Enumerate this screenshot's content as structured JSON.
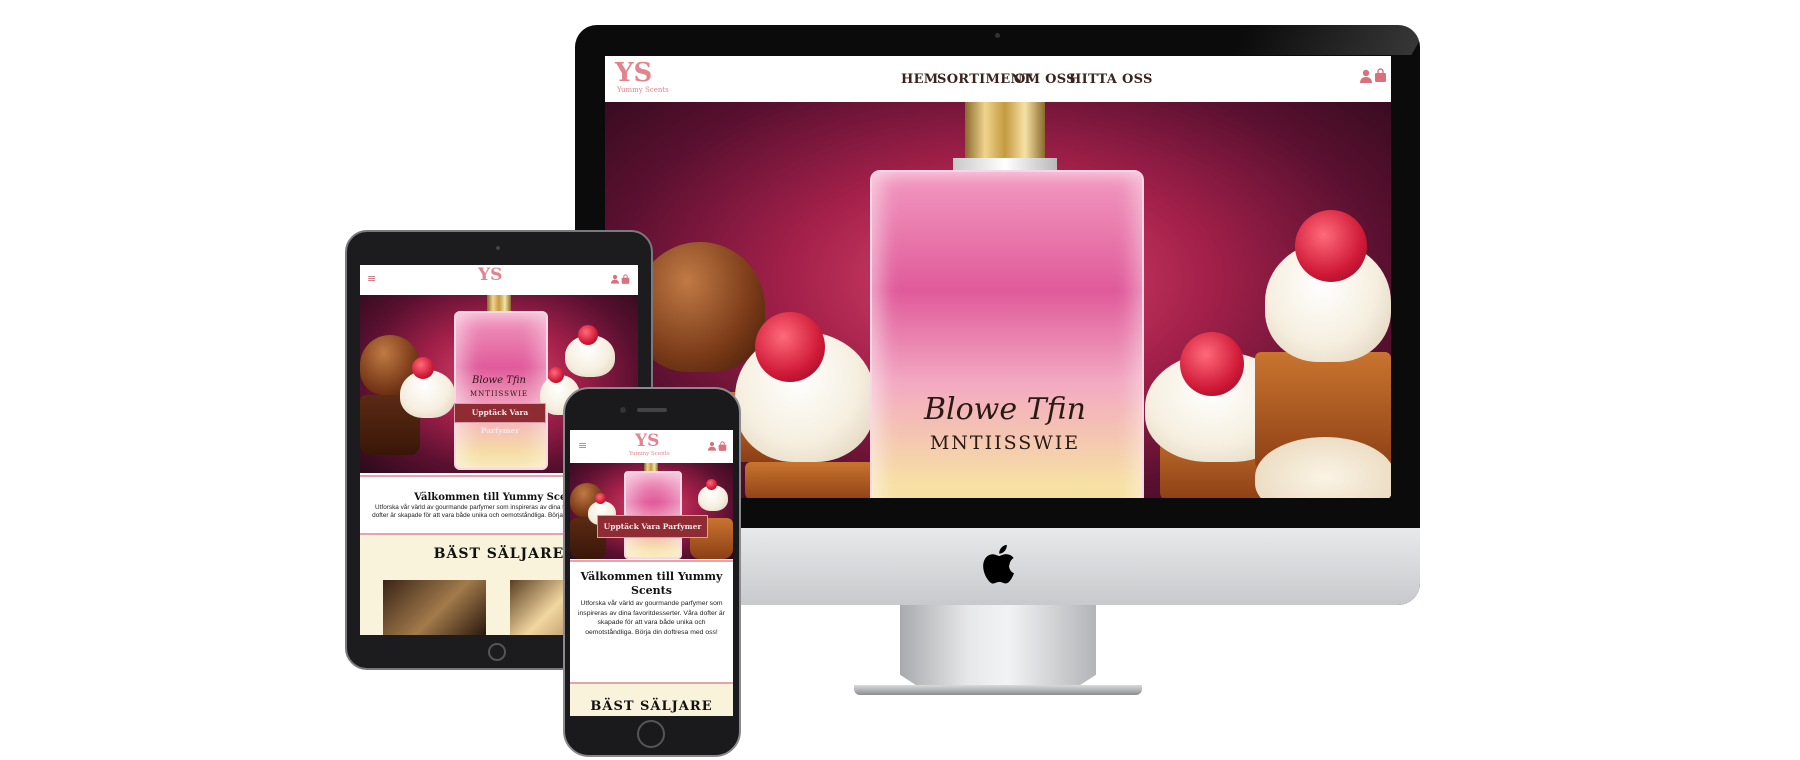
{
  "brand": {
    "logo_letters": "YS",
    "logo_name": "Yummy Scents",
    "accent": "#e2838e",
    "dark_red": "#8f2b33",
    "cream": "#f8f3da"
  },
  "desktop": {
    "nav": {
      "links": [
        "HEM",
        "SORTIMENT",
        "OM OSS",
        "HITTA OSS"
      ],
      "icons": [
        "user-icon",
        "shopping-bag-icon"
      ]
    },
    "hero": {
      "bottle_label_line1": "Blowe Tfin",
      "bottle_label_line2": "MNTIISSWIE"
    }
  },
  "tablet": {
    "cta": "Upptäck Vara Parfymer",
    "welcome_title": "Välkommen till Yummy Scents",
    "welcome_text": "Utforska vår värld av gourmande parfymer som inspireras av dina favoritdesserter. Våra dofter är skapade för att vara både unika och oemotståndliga. Börja din doftresa med oss!",
    "best_sellers": "BÄST SÄLJARE",
    "bottle_label_line1": "Blowe Tfin",
    "bottle_label_line2": "MNTIISSWIE"
  },
  "phone": {
    "cta": "Upptäck Vara Parfymer",
    "welcome_title": "Välkommen till Yummy Scents",
    "welcome_text": "Utforska vår värld av gourmande parfymer som inspireras av dina favoritdesserter. Våra dofter är skapade för att vara både unika och oemotståndliga. Börja din doftresa med oss!",
    "best_sellers": "BÄST SÄLJARE"
  }
}
